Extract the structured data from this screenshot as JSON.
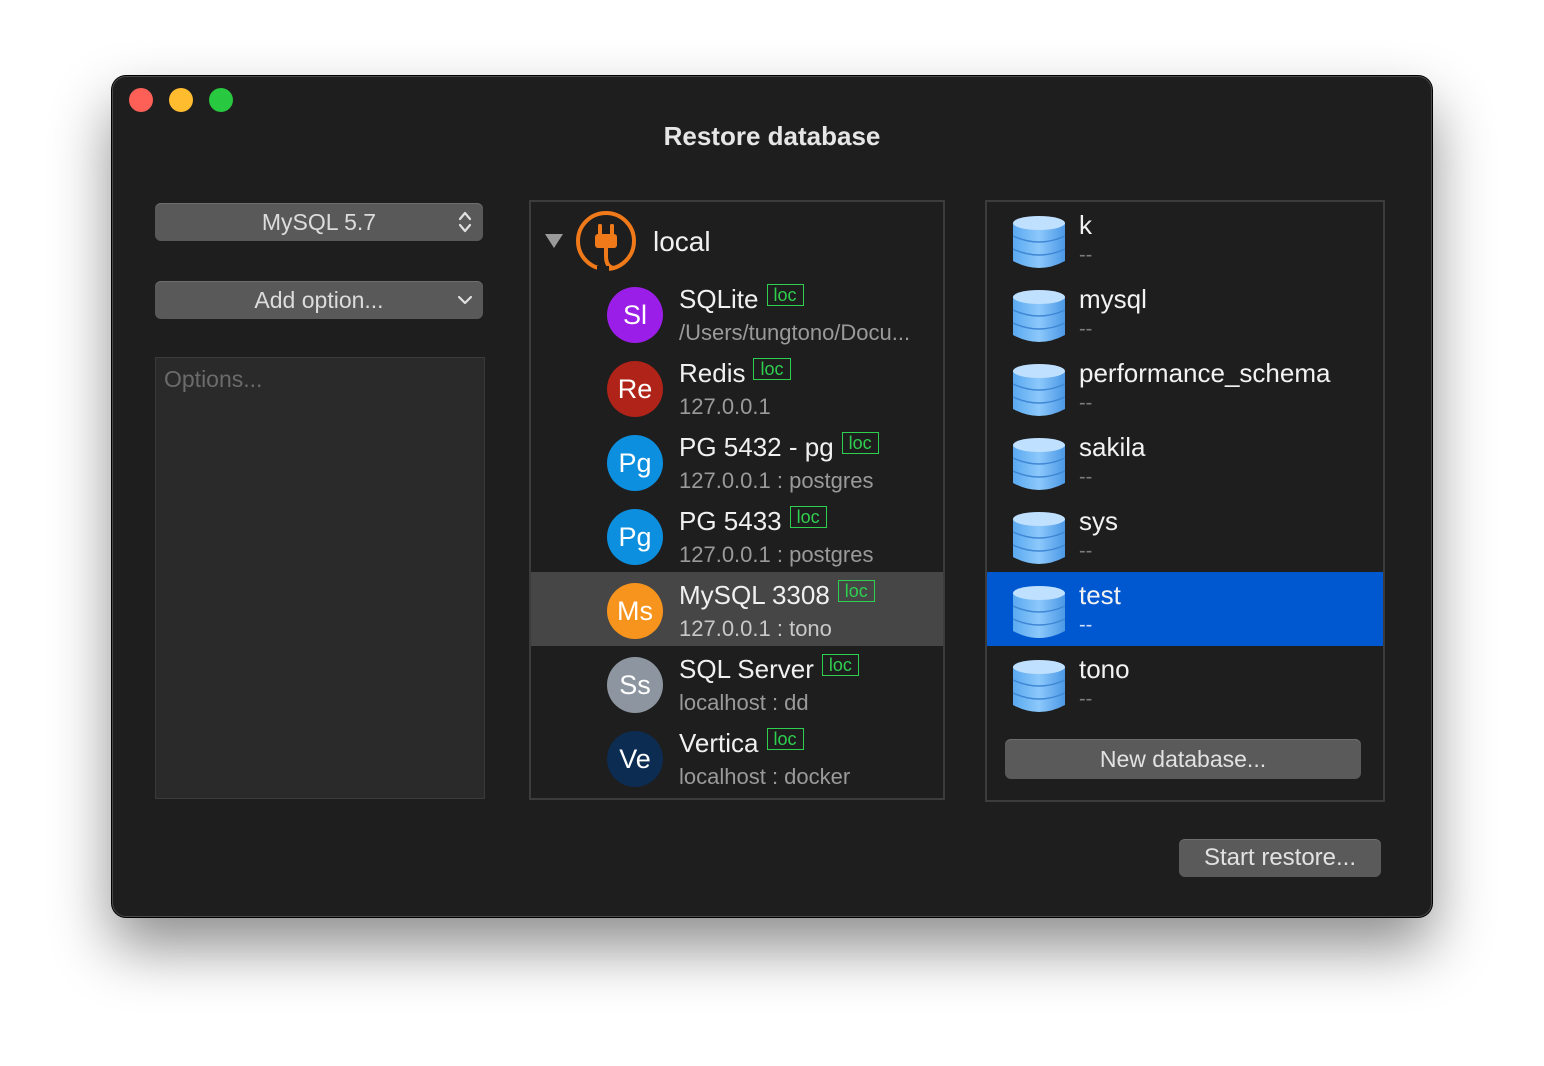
{
  "window": {
    "title": "Restore database"
  },
  "left": {
    "version_select": "MySQL 5.7",
    "add_option": "Add option...",
    "options_placeholder": "Options..."
  },
  "connections": {
    "group": "local",
    "items": [
      {
        "abbr": "Sl",
        "name": "SQLite",
        "badge": "loc",
        "detail": "/Users/tungtono/Docu...",
        "color": "#9b1ee8"
      },
      {
        "abbr": "Re",
        "name": "Redis",
        "badge": "loc",
        "detail": "127.0.0.1",
        "color": "#b02318"
      },
      {
        "abbr": "Pg",
        "name": "PG 5432 - pg",
        "badge": "loc",
        "detail": "127.0.0.1 : postgres",
        "color": "#0d8fe0"
      },
      {
        "abbr": "Pg",
        "name": "PG 5433",
        "badge": "loc",
        "detail": "127.0.0.1 : postgres",
        "color": "#0d8fe0"
      },
      {
        "abbr": "Ms",
        "name": "MySQL 3308",
        "badge": "loc",
        "detail": "127.0.0.1 : tono",
        "color": "#f7941d",
        "selected": true
      },
      {
        "abbr": "Ss",
        "name": "SQL Server",
        "badge": "loc",
        "detail": "localhost : dd",
        "color": "#8d96a0"
      },
      {
        "abbr": "Ve",
        "name": "Vertica",
        "badge": "loc",
        "detail": "localhost : docker",
        "color": "#0c2c52"
      }
    ]
  },
  "databases": {
    "items": [
      {
        "name": "k",
        "detail": "--"
      },
      {
        "name": "mysql",
        "detail": "--"
      },
      {
        "name": "performance_schema",
        "detail": "--"
      },
      {
        "name": "sakila",
        "detail": "--"
      },
      {
        "name": "sys",
        "detail": "--"
      },
      {
        "name": "test",
        "detail": "--",
        "selected": true
      },
      {
        "name": "tono",
        "detail": "--"
      }
    ],
    "new_button": "New database..."
  },
  "footer": {
    "start_button": "Start restore..."
  },
  "colors": {
    "accent": "#0058d0",
    "badge": "#2fcf4f",
    "plug": "#f07a1a"
  }
}
